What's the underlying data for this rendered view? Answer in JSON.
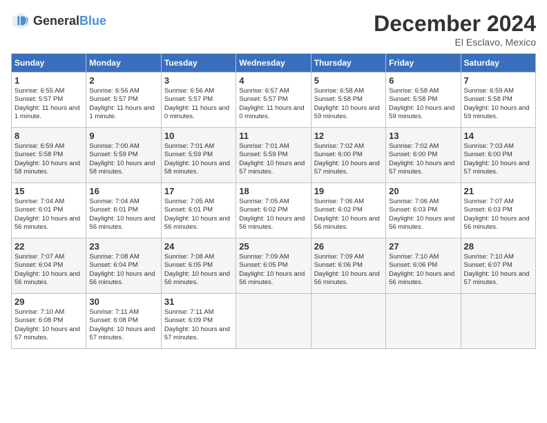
{
  "header": {
    "logo_general": "General",
    "logo_blue": "Blue",
    "month_title": "December 2024",
    "location": "El Esclavo, Mexico"
  },
  "days_of_week": [
    "Sunday",
    "Monday",
    "Tuesday",
    "Wednesday",
    "Thursday",
    "Friday",
    "Saturday"
  ],
  "weeks": [
    [
      {
        "day": "1",
        "info": "Sunrise: 6:55 AM\nSunset: 5:57 PM\nDaylight: 11 hours and 1 minute."
      },
      {
        "day": "2",
        "info": "Sunrise: 6:56 AM\nSunset: 5:57 PM\nDaylight: 11 hours and 1 minute."
      },
      {
        "day": "3",
        "info": "Sunrise: 6:56 AM\nSunset: 5:57 PM\nDaylight: 11 hours and 0 minutes."
      },
      {
        "day": "4",
        "info": "Sunrise: 6:57 AM\nSunset: 5:57 PM\nDaylight: 11 hours and 0 minutes."
      },
      {
        "day": "5",
        "info": "Sunrise: 6:58 AM\nSunset: 5:58 PM\nDaylight: 10 hours and 59 minutes."
      },
      {
        "day": "6",
        "info": "Sunrise: 6:58 AM\nSunset: 5:58 PM\nDaylight: 10 hours and 59 minutes."
      },
      {
        "day": "7",
        "info": "Sunrise: 6:59 AM\nSunset: 5:58 PM\nDaylight: 10 hours and 59 minutes."
      }
    ],
    [
      {
        "day": "8",
        "info": "Sunrise: 6:59 AM\nSunset: 5:58 PM\nDaylight: 10 hours and 58 minutes."
      },
      {
        "day": "9",
        "info": "Sunrise: 7:00 AM\nSunset: 5:59 PM\nDaylight: 10 hours and 58 minutes."
      },
      {
        "day": "10",
        "info": "Sunrise: 7:01 AM\nSunset: 5:59 PM\nDaylight: 10 hours and 58 minutes."
      },
      {
        "day": "11",
        "info": "Sunrise: 7:01 AM\nSunset: 5:59 PM\nDaylight: 10 hours and 57 minutes."
      },
      {
        "day": "12",
        "info": "Sunrise: 7:02 AM\nSunset: 6:00 PM\nDaylight: 10 hours and 57 minutes."
      },
      {
        "day": "13",
        "info": "Sunrise: 7:02 AM\nSunset: 6:00 PM\nDaylight: 10 hours and 57 minutes."
      },
      {
        "day": "14",
        "info": "Sunrise: 7:03 AM\nSunset: 6:00 PM\nDaylight: 10 hours and 57 minutes."
      }
    ],
    [
      {
        "day": "15",
        "info": "Sunrise: 7:04 AM\nSunset: 6:01 PM\nDaylight: 10 hours and 56 minutes."
      },
      {
        "day": "16",
        "info": "Sunrise: 7:04 AM\nSunset: 6:01 PM\nDaylight: 10 hours and 56 minutes."
      },
      {
        "day": "17",
        "info": "Sunrise: 7:05 AM\nSunset: 6:01 PM\nDaylight: 10 hours and 56 minutes."
      },
      {
        "day": "18",
        "info": "Sunrise: 7:05 AM\nSunset: 6:02 PM\nDaylight: 10 hours and 56 minutes."
      },
      {
        "day": "19",
        "info": "Sunrise: 7:06 AM\nSunset: 6:02 PM\nDaylight: 10 hours and 56 minutes."
      },
      {
        "day": "20",
        "info": "Sunrise: 7:06 AM\nSunset: 6:03 PM\nDaylight: 10 hours and 56 minutes."
      },
      {
        "day": "21",
        "info": "Sunrise: 7:07 AM\nSunset: 6:03 PM\nDaylight: 10 hours and 56 minutes."
      }
    ],
    [
      {
        "day": "22",
        "info": "Sunrise: 7:07 AM\nSunset: 6:04 PM\nDaylight: 10 hours and 56 minutes."
      },
      {
        "day": "23",
        "info": "Sunrise: 7:08 AM\nSunset: 6:04 PM\nDaylight: 10 hours and 56 minutes."
      },
      {
        "day": "24",
        "info": "Sunrise: 7:08 AM\nSunset: 6:05 PM\nDaylight: 10 hours and 56 minutes."
      },
      {
        "day": "25",
        "info": "Sunrise: 7:09 AM\nSunset: 6:05 PM\nDaylight: 10 hours and 56 minutes."
      },
      {
        "day": "26",
        "info": "Sunrise: 7:09 AM\nSunset: 6:06 PM\nDaylight: 10 hours and 56 minutes."
      },
      {
        "day": "27",
        "info": "Sunrise: 7:10 AM\nSunset: 6:06 PM\nDaylight: 10 hours and 56 minutes."
      },
      {
        "day": "28",
        "info": "Sunrise: 7:10 AM\nSunset: 6:07 PM\nDaylight: 10 hours and 57 minutes."
      }
    ],
    [
      {
        "day": "29",
        "info": "Sunrise: 7:10 AM\nSunset: 6:08 PM\nDaylight: 10 hours and 57 minutes."
      },
      {
        "day": "30",
        "info": "Sunrise: 7:11 AM\nSunset: 6:08 PM\nDaylight: 10 hours and 57 minutes."
      },
      {
        "day": "31",
        "info": "Sunrise: 7:11 AM\nSunset: 6:09 PM\nDaylight: 10 hours and 57 minutes."
      },
      {
        "day": "",
        "info": ""
      },
      {
        "day": "",
        "info": ""
      },
      {
        "day": "",
        "info": ""
      },
      {
        "day": "",
        "info": ""
      }
    ]
  ]
}
